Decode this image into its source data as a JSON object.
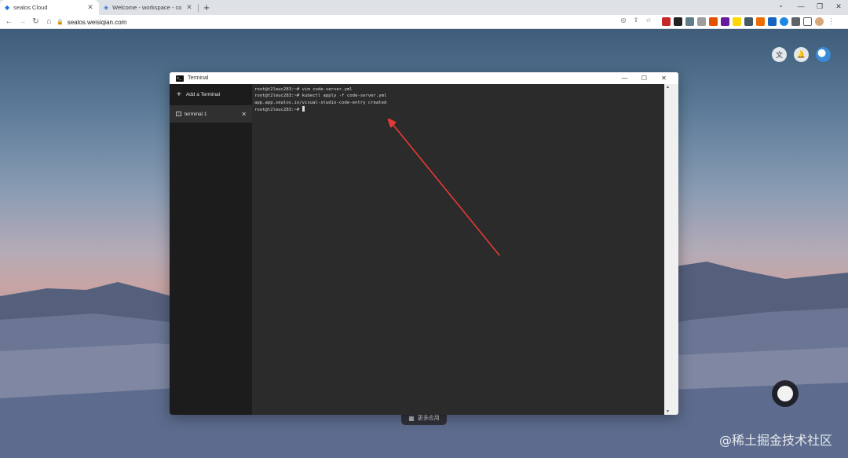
{
  "browser": {
    "tabs": [
      {
        "title": "sealos Cloud",
        "active": true
      },
      {
        "title": "Welcome - workspace - code-",
        "active": false
      }
    ],
    "new_tab": "+",
    "address": "sealos.weisiqian.com",
    "window_controls": {
      "minimize": "—",
      "restore": "❐",
      "close": "✕"
    },
    "tab_search": "⌄"
  },
  "desktop": {
    "dock_label": "更多应用",
    "watermark": "@稀土掘金技术社区"
  },
  "terminal": {
    "window_title": "Terminal",
    "add_terminal_label": "Add a Terminal",
    "tabs": [
      {
        "label": "terminal 1"
      }
    ],
    "lines": [
      "root@t2leuc283:~# vim code-server.yml",
      "root@t2leuc283:~# kubectl apply -f code-server.yml",
      "app.app.sealos.io/visual-studio-code-entry created",
      "root@t2leuc283:~# "
    ]
  },
  "colors": {
    "annotation_arrow": "#e53935",
    "terminal_bg": "#2b2b2b",
    "sidebar_bg": "#1c1c1c"
  },
  "icons": [
    "sealos-logo-icon",
    "vscode-icon",
    "back-icon",
    "forward-icon",
    "reload-icon",
    "home-icon",
    "lock-icon",
    "bookmark-star-icon",
    "translate-icon",
    "bell-icon",
    "avatar",
    "terminal-app-icon",
    "plus-icon",
    "close-icon",
    "apps-grid-icon"
  ]
}
